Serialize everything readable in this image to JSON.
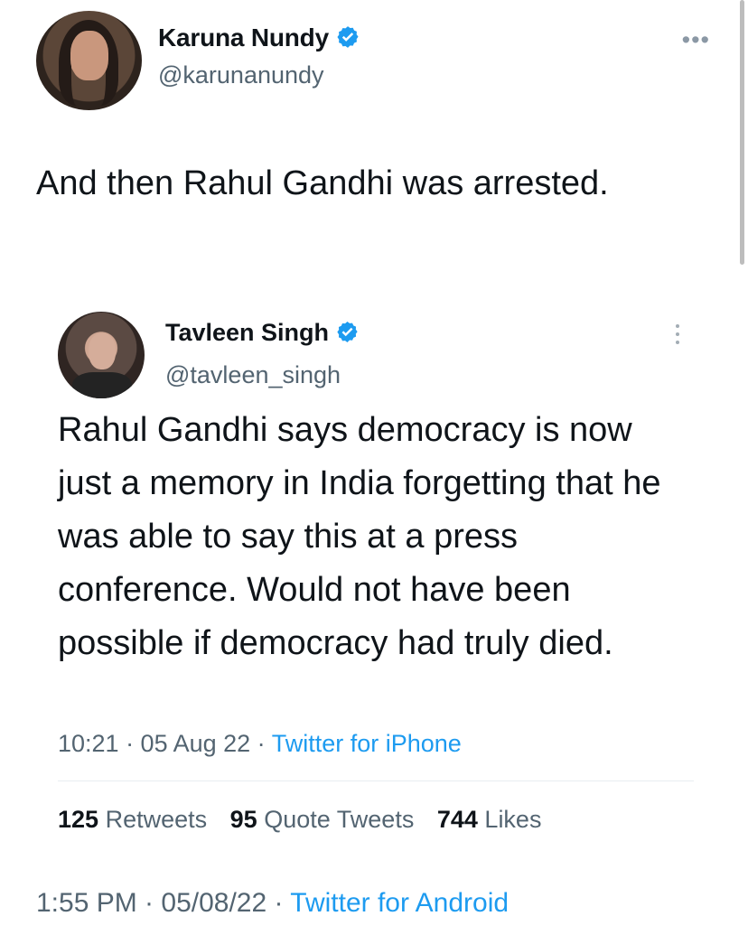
{
  "tweet": {
    "author": {
      "name": "Karuna Nundy",
      "handle": "@karunanundy",
      "verified_icon": "verified-badge-icon"
    },
    "text": "And then Rahul Gandhi was arrested.",
    "timestamp": "1:55 PM · 05/08/22 · ",
    "source": "Twitter for Android"
  },
  "quote": {
    "author": {
      "name": "Tavleen Singh",
      "handle": "@tavleen_singh",
      "verified_icon": "verified-badge-icon"
    },
    "text": "Rahul Gandhi says democracy is now just a memory in India forgetting that he was able to say this at a press conference. Would not have been possible if democracy had truly died.",
    "timestamp": "10:21 · 05 Aug 22 · ",
    "source": "Twitter for iPhone",
    "stats": {
      "retweets_count": "125",
      "retweets_label": "Retweets",
      "quote_count": "95",
      "quote_label": "Quote Tweets",
      "likes_count": "744",
      "likes_label": "Likes"
    }
  },
  "ui": {
    "more_menu_icon": "•••",
    "accent_color": "#1d9bf0",
    "secondary_text_color": "#536471"
  }
}
